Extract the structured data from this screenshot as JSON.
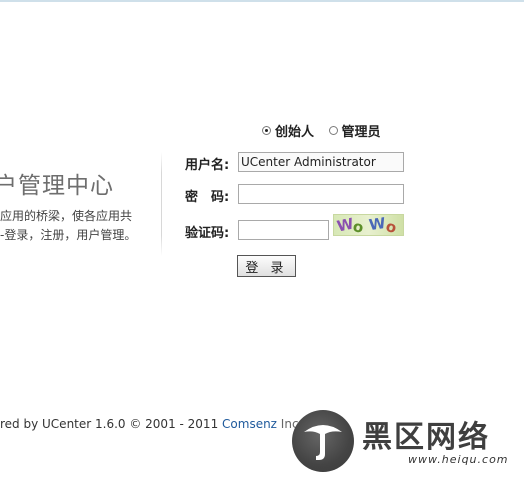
{
  "intro": {
    "title": "户管理中心",
    "line1": "应用的桥梁，使各应用共",
    "line2": "-登录，注册，用户管理。"
  },
  "roles": [
    {
      "label": "创始人",
      "checked": true
    },
    {
      "label": "管理员",
      "checked": false
    }
  ],
  "form": {
    "username_label": "用户名:",
    "username_value": "UCenter Administrator",
    "password_label": "密　码:",
    "password_value": "",
    "captcha_label": "验证码:",
    "captcha_value": "",
    "captcha_chars": [
      "W",
      "o",
      "W",
      "o"
    ],
    "login_label": "登 录"
  },
  "footer": {
    "text": "red by UCenter 1.6.0 © 2001 - 2011 ",
    "brand": "Comsenz",
    "suffix": " Inc."
  },
  "watermark": {
    "logo_icon": "heiqu-logo-icon",
    "text": "黑区网络",
    "url": "www.heiqu.com"
  }
}
